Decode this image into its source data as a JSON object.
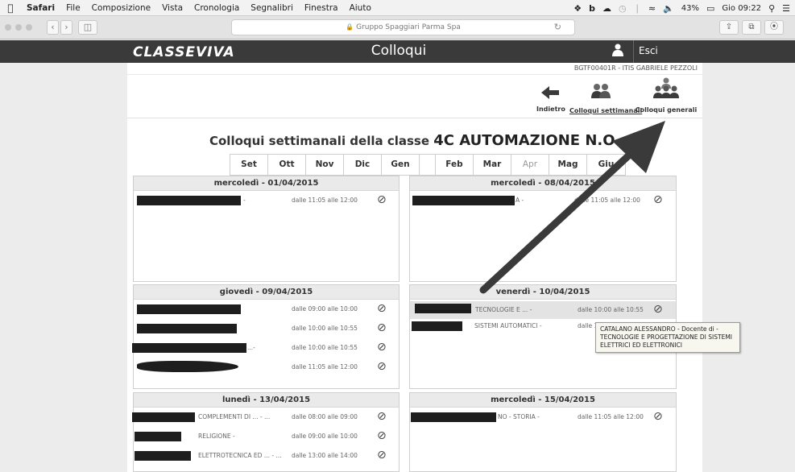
{
  "menubar": {
    "app": "Safari",
    "items": [
      "File",
      "Composizione",
      "Vista",
      "Cronologia",
      "Segnalibri",
      "Finestra",
      "Aiuto"
    ],
    "battery": "43%",
    "clock": "Gio 09:22"
  },
  "toolbar": {
    "url_text": "Gruppo Spaggiari Parma Spa"
  },
  "header": {
    "logo": "CLASSEVIVA",
    "title": "Colloqui",
    "exit_label": "Esci"
  },
  "user_line": "BGTF00401R - ITIS   GABRIELE PEZZOLI",
  "nav": {
    "back": "Indietro",
    "weekly": "Colloqui settimanali",
    "general": "Colloqui generali"
  },
  "page_title": {
    "prefix": "Colloqui settimanali della classe",
    "class_name": "4C AUTOMAZIONE N.O."
  },
  "months": [
    {
      "label": "Set"
    },
    {
      "label": "Ott"
    },
    {
      "label": "Nov"
    },
    {
      "label": "Dic"
    },
    {
      "label": "Gen"
    },
    {
      "label": "Feb"
    },
    {
      "label": "Mar"
    },
    {
      "label": "Apr"
    },
    {
      "label": "Mag"
    },
    {
      "label": "Giu"
    }
  ],
  "days": [
    {
      "header": "mercoledì - 01/04/2015",
      "rows": [
        {
          "subject": "-",
          "time": "dalle 11:05 alle 12:00"
        }
      ]
    },
    {
      "header": "mercoledì - 08/04/2015",
      "rows": [
        {
          "subject": "A -",
          "time": "dalle 11:05 alle 12:00"
        }
      ]
    },
    {
      "header": "giovedì - 09/04/2015",
      "rows": [
        {
          "subject": "",
          "time": "dalle 09:00 alle 10:00"
        },
        {
          "subject": "",
          "time": "dalle 10:00 alle 10:55"
        },
        {
          "subject": "...-",
          "time": "dalle 10:00 alle 10:55"
        },
        {
          "subject": "",
          "time": "dalle 11:05 alle 12:00"
        }
      ]
    },
    {
      "header": "venerdì - 10/04/2015",
      "rows": [
        {
          "subject": "TECNOLOGIE E ... -",
          "time": "dalle 10:00 alle 10:55"
        },
        {
          "subject": "SISTEMI AUTOMATICI -",
          "time": "dalle 12:"
        }
      ]
    },
    {
      "header": "lunedì - 13/04/2015",
      "rows": [
        {
          "subject": "COMPLEMENTI DI ... - ...",
          "time": "dalle 08:00 alle 09:00"
        },
        {
          "subject": "RELIGIONE -",
          "time": "dalle 09:00 alle 10:00"
        },
        {
          "subject": "ELETTROTECNICA ED ... - ...",
          "time": "dalle 13:00 alle 14:00"
        }
      ]
    },
    {
      "header": "mercoledì - 15/04/2015",
      "rows": [
        {
          "subject": "NO - STORIA -",
          "time": "dalle 11:05 alle 12:00"
        }
      ]
    }
  ],
  "tooltip": "CATALANO ALESSANDRO - Docente di - TECNOLOGIE E PROGETTAZIONE DI SISTEMI ELETTRICI ED ELETTRONICI",
  "icons": {
    "apple": "apple-logo-icon",
    "user": "user-icon",
    "back": "arrow-left-icon",
    "weekly": "group-icon",
    "general": "crowd-icon",
    "no_booking": "prohibited-icon"
  },
  "colors": {
    "header_bg": "#3a3a3a",
    "arrow": "#3a3a3a",
    "redaction": "#1e1e1e"
  }
}
